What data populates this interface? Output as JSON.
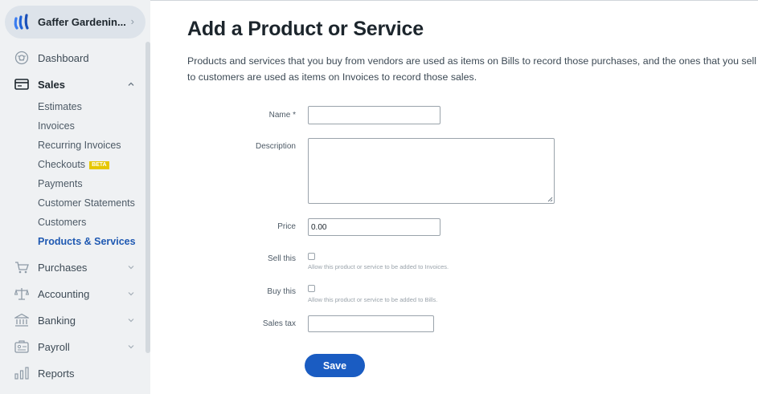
{
  "sidebar": {
    "business_name": "Gaffer Gardenin...",
    "items": {
      "dashboard": "Dashboard",
      "sales": "Sales",
      "purchases": "Purchases",
      "accounting": "Accounting",
      "banking": "Banking",
      "payroll": "Payroll",
      "reports": "Reports"
    },
    "sales_sub": {
      "estimates": "Estimates",
      "invoices": "Invoices",
      "recurring_invoices": "Recurring Invoices",
      "checkouts": "Checkouts",
      "beta": "BETA",
      "payments": "Payments",
      "customer_statements": "Customer Statements",
      "customers": "Customers",
      "products_services": "Products & Services"
    },
    "active_color": "#1f59b2"
  },
  "page": {
    "title": "Add a Product or Service",
    "description": "Products and services that you buy from vendors are used as items on Bills to record those purchases, and the ones that you sell to customers are used as items on Invoices to record those sales."
  },
  "form": {
    "name_label": "Name *",
    "name_value": "",
    "description_label": "Description",
    "description_value": "",
    "price_label": "Price",
    "price_value": "0.00",
    "sell_label": "Sell this",
    "sell_hint": "Allow this product or service to be added to Invoices.",
    "sell_checked": false,
    "buy_label": "Buy this",
    "buy_hint": "Allow this product or service to be added to Bills.",
    "buy_checked": false,
    "sales_tax_label": "Sales tax",
    "sales_tax_value": "",
    "save_label": "Save",
    "save_color": "#1a5cc2"
  }
}
